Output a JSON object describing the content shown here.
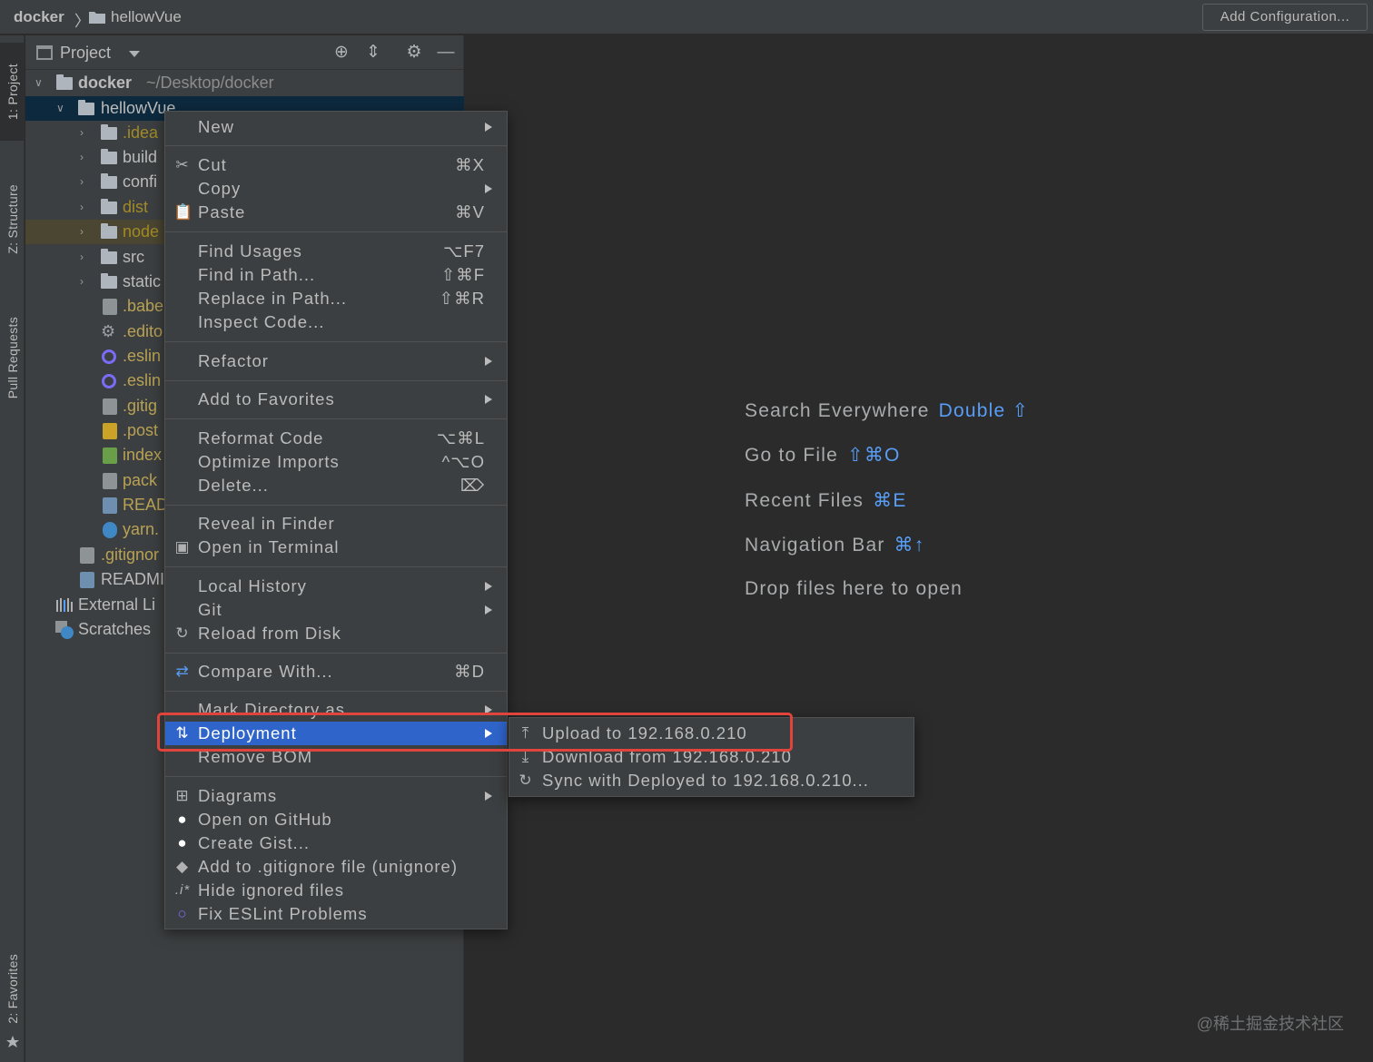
{
  "navbar": {
    "root": "docker",
    "separator": "〉",
    "child": "hellowVue",
    "add_config": "Add Configuration..."
  },
  "left_stripe": {
    "project": "1: Project",
    "structure": "Z: Structure",
    "pull_requests": "Pull Requests",
    "favorites": "2: Favorites"
  },
  "panel": {
    "title": "Project"
  },
  "tree": [
    {
      "label": "docker",
      "path": "~/Desktop/docker"
    },
    {
      "label": "hellowVue"
    },
    {
      "label": ".idea"
    },
    {
      "label": "build"
    },
    {
      "label": "confi"
    },
    {
      "label": "dist"
    },
    {
      "label": "node"
    },
    {
      "label": "src"
    },
    {
      "label": "static"
    },
    {
      "label": ".babe"
    },
    {
      "label": ".edito"
    },
    {
      "label": ".eslin"
    },
    {
      "label": ".eslin"
    },
    {
      "label": ".gitig"
    },
    {
      "label": ".post"
    },
    {
      "label": "index"
    },
    {
      "label": "pack"
    },
    {
      "label": "READ"
    },
    {
      "label": "yarn."
    },
    {
      "label": ".gitignor"
    },
    {
      "label": "READMI"
    },
    {
      "label": "External Li"
    },
    {
      "label": "Scratches"
    }
  ],
  "hints": [
    {
      "text": "Search Everywhere",
      "key": "Double ⇧"
    },
    {
      "text": "Go to File",
      "key": "⇧⌘O"
    },
    {
      "text": "Recent Files",
      "key": "⌘E"
    },
    {
      "text": "Navigation Bar",
      "key": "⌘↑"
    },
    {
      "text": "Drop files here to open",
      "key": ""
    }
  ],
  "menu": {
    "new": "New",
    "cut": "Cut",
    "cut_key": "⌘X",
    "copy": "Copy",
    "paste": "Paste",
    "paste_key": "⌘V",
    "find_usages": "Find Usages",
    "find_usages_key": "⌥F7",
    "find_in_path": "Find in Path...",
    "find_in_path_key": "⇧⌘F",
    "replace_in_path": "Replace in Path...",
    "replace_in_path_key": "⇧⌘R",
    "inspect_code": "Inspect Code...",
    "refactor": "Refactor",
    "add_favorites": "Add to Favorites",
    "reformat": "Reformat Code",
    "reformat_key": "⌥⌘L",
    "optimize": "Optimize Imports",
    "optimize_key": "^⌥O",
    "delete": "Delete...",
    "delete_key": "⌦",
    "reveal": "Reveal in Finder",
    "terminal": "Open in Terminal",
    "local_history": "Local History",
    "git": "Git",
    "reload": "Reload from Disk",
    "compare": "Compare With...",
    "compare_key": "⌘D",
    "mark_dir": "Mark Directory as",
    "deployment": "Deployment",
    "remove_bom": "Remove BOM",
    "diagrams": "Diagrams",
    "github": "Open on GitHub",
    "gist": "Create Gist...",
    "gitignore": "Add to .gitignore file (unignore)",
    "hide_ignored": "Hide ignored files",
    "eslint": "Fix ESLint Problems"
  },
  "submenu": {
    "upload": "Upload to 192.168.0.210",
    "download": "Download from 192.168.0.210",
    "sync": "Sync with Deployed to 192.168.0.210..."
  },
  "watermark": "@稀土掘金技术社区"
}
